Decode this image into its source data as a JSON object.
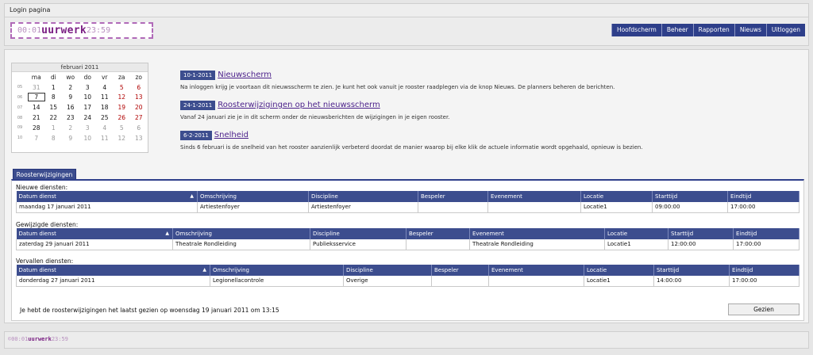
{
  "window": {
    "title": "Login pagina"
  },
  "logo": {
    "prefix": "00:01",
    "brand": "uurwerk",
    "suffix": "23:59"
  },
  "nav": [
    "Hoofdscherm",
    "Beheer",
    "Rapporten",
    "Nieuws",
    "Uitloggen"
  ],
  "calendar": {
    "month": "februari 2011",
    "weekdays": [
      "ma",
      "di",
      "wo",
      "do",
      "vr",
      "za",
      "zo"
    ],
    "weeks": [
      {
        "wk": "05",
        "days": [
          "31",
          "1",
          "2",
          "3",
          "4",
          "5",
          "6"
        ]
      },
      {
        "wk": "06",
        "days": [
          "7",
          "8",
          "9",
          "10",
          "11",
          "12",
          "13"
        ]
      },
      {
        "wk": "07",
        "days": [
          "14",
          "15",
          "16",
          "17",
          "18",
          "19",
          "20"
        ]
      },
      {
        "wk": "08",
        "days": [
          "21",
          "22",
          "23",
          "24",
          "25",
          "26",
          "27"
        ]
      },
      {
        "wk": "09",
        "days": [
          "28",
          "1",
          "2",
          "3",
          "4",
          "5",
          "6"
        ]
      },
      {
        "wk": "10",
        "days": [
          "7",
          "8",
          "9",
          "10",
          "11",
          "12",
          "13"
        ]
      }
    ],
    "today": "7",
    "colors": {
      "weekend": "#b00000",
      "other_month": "#999999"
    }
  },
  "news": [
    {
      "date": "10-1-2011",
      "title": "Nieuwscherm",
      "body": "Na inloggen krijg je voortaan dit nieuwsscherm te zien. Je kunt het ook vanuit je rooster raadplegen via de knop Nieuws. De planners beheren de berichten."
    },
    {
      "date": "24-1-2011",
      "title": "Roosterwijzigingen op het nieuwsscherm",
      "body": "Vanaf 24 januari zie je in dit scherm onder de nieuwsberichten de wijzigingen in je eigen rooster."
    },
    {
      "date": "6-2-2011",
      "title": "Snelheid",
      "body": "Sinds 6 februari is de snelheid van het rooster aanzienlijk verbeterd doordat de manier waarop bij elke klik de actuele informatie wordt opgehaald, opnieuw is bezien."
    }
  ],
  "tab": {
    "label": "Roosterwijzigingen"
  },
  "sections": [
    {
      "label": "Nieuwe diensten:",
      "headers": [
        "Datum dienst",
        "Omschrijving",
        "Discipline",
        "Bespeler",
        "Evenement",
        "Locatie",
        "Starttijd",
        "Eindtijd"
      ],
      "sort_indicator": "▲",
      "rows": [
        [
          "maandag 17 januari 2011",
          "Artiestenfoyer",
          "Artiestenfoyer",
          "",
          "",
          "Locatie1",
          "09:00:00",
          "17:00:00"
        ]
      ]
    },
    {
      "label": "Gewijzigde diensten:",
      "headers": [
        "Datum dienst",
        "Omschrijving",
        "Discipline",
        "Bespeler",
        "Evenement",
        "Locatie",
        "Starttijd",
        "Eindtijd"
      ],
      "sort_indicator": "▲",
      "rows": [
        [
          "zaterdag 29 januari 2011",
          "Theatrale Rondleiding",
          "Publieksservice",
          "",
          "Theatrale Rondleiding",
          "Locatie1",
          "12:00:00",
          "17:00:00"
        ]
      ]
    },
    {
      "label": "Vervallen diensten:",
      "headers": [
        "Datum dienst",
        "Omschrijving",
        "Discipline",
        "Bespeler",
        "Evenement",
        "Locatie",
        "Starttijd",
        "Eindtijd"
      ],
      "sort_indicator": "▲",
      "rows": [
        [
          "donderdag 27 januari 2011",
          "Legionellacontrole",
          "Overige",
          "",
          "",
          "Locatie1",
          "14:00:00",
          "17:00:00"
        ]
      ]
    }
  ],
  "footer": {
    "last_seen_text": "Je hebt de roosterwijzigingen het laatst gezien op woensdag 19 januari 2011 om 13:15",
    "button": "Gezien"
  },
  "bottom_logo": {
    "copyright": "©",
    "prefix": "00:01",
    "brand": "uurwerk",
    "suffix": "23:59"
  },
  "colors": {
    "primary": "#3c4d8e",
    "brand": "#7a1f83",
    "link": "#4a1f8a"
  }
}
